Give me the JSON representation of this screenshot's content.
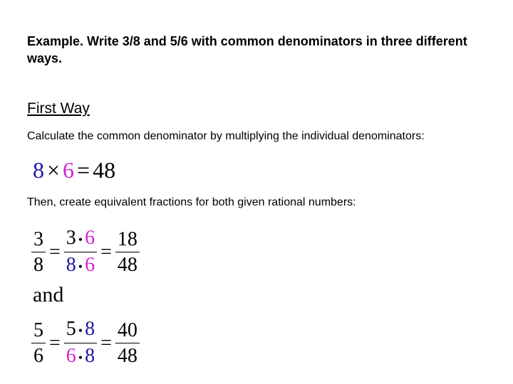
{
  "title": "Example. Write 3/8 and 5/6 with common denominators in three different ways.",
  "section_heading": "First Way",
  "step1_text": "Calculate the common denominator  by multiplying the individual denominators:",
  "equation1": {
    "a": "8",
    "times": "×",
    "b": "6",
    "equals": "=",
    "result": "48"
  },
  "step2_text": "Then, create equivalent fractions for both given rational numbers:",
  "fraction1": {
    "num": "3",
    "den": "8",
    "mid_num_a": "3",
    "mid_num_b": "6",
    "mid_den_a": "8",
    "mid_den_b": "6",
    "res_num": "18",
    "res_den": "48"
  },
  "connector": "and",
  "fraction2": {
    "num": "5",
    "den": "6",
    "mid_num_a": "5",
    "mid_num_b": "8",
    "mid_den_a": "6",
    "mid_den_b": "8",
    "res_num": "40",
    "res_den": "48"
  },
  "symbols": {
    "dot": "•",
    "equals": "="
  },
  "colors": {
    "blue": "#1a1aa6",
    "magenta": "#d422d4"
  }
}
